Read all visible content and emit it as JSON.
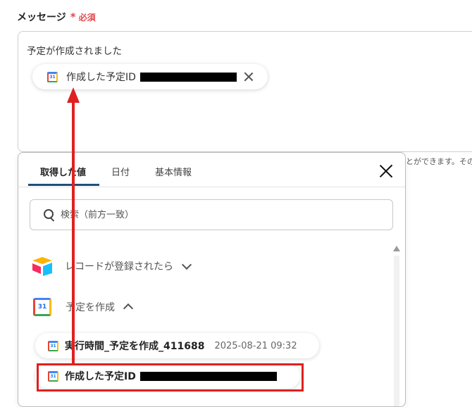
{
  "field": {
    "label": "メッセージ",
    "required_mark": "*",
    "required_text": "必須"
  },
  "message": {
    "text": "予定が作成されました",
    "chip_label": "作成した予定ID"
  },
  "helper_text": "とができます。その",
  "panel": {
    "tabs": [
      "取得した値",
      "日付",
      "基本情報"
    ],
    "active_tab": 0,
    "search_placeholder": "検索（前方一致）",
    "sections": [
      {
        "label": "レコードが登録されたら",
        "icon": "airtable-icon",
        "expanded": false
      },
      {
        "label": "予定を作成",
        "icon": "google-calendar-icon",
        "expanded": true
      }
    ],
    "items": [
      {
        "label": "実行時間_予定を作成_411688",
        "value": "2025-08-21 09:32"
      },
      {
        "label": "作成した予定ID",
        "value_redacted": true
      }
    ]
  },
  "colors": {
    "required": "#e5484d",
    "annotation": "#e02020",
    "tab_underline": "#1e4f7a"
  }
}
